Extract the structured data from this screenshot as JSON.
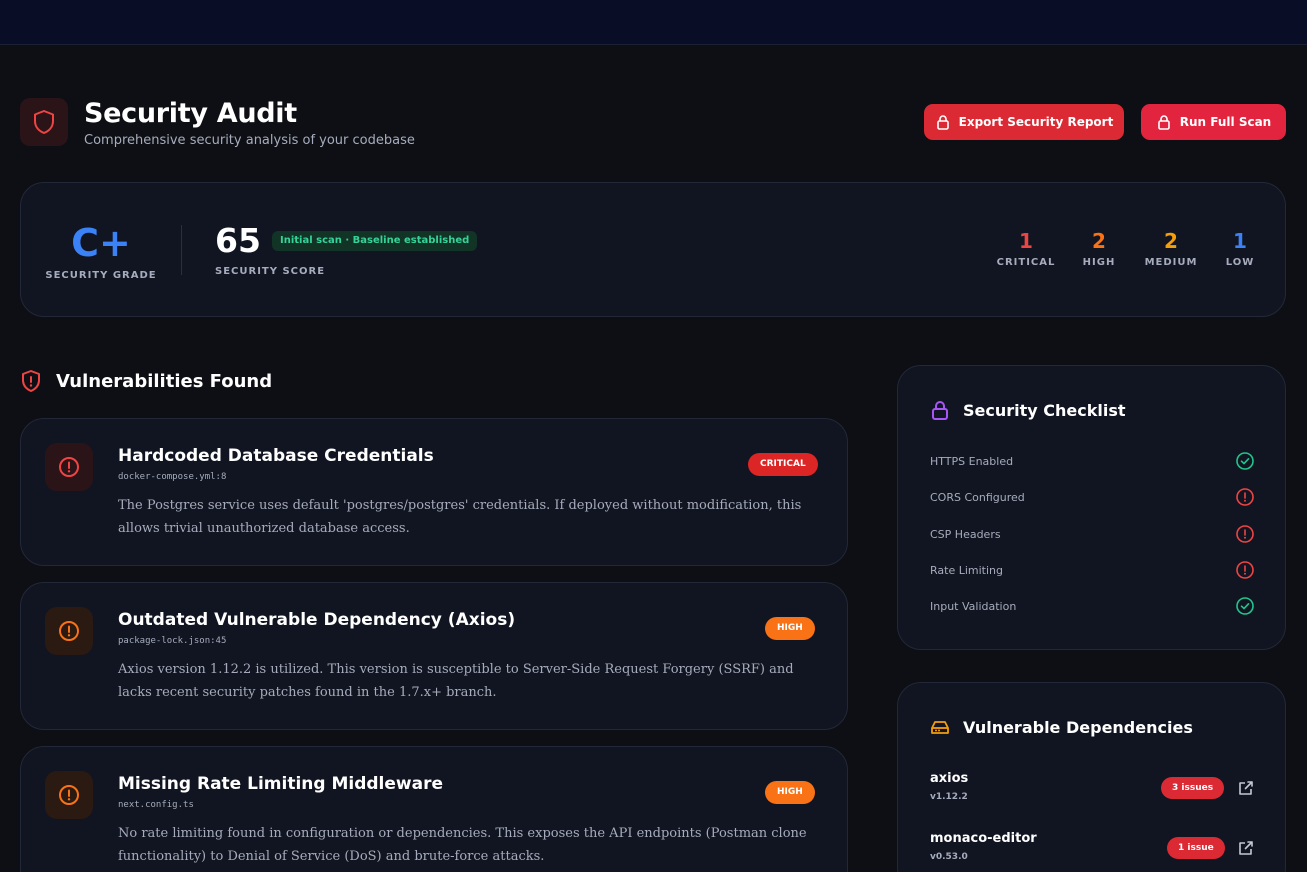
{
  "header": {
    "title": "Security Audit",
    "subtitle": "Comprehensive security analysis of your codebase",
    "export_label": "Export Security Report",
    "scan_label": "Run Full Scan"
  },
  "score_card": {
    "grade": "C+",
    "grade_label": "SECURITY GRADE",
    "score": "65",
    "score_badge": "Initial scan · Baseline established",
    "score_label": "SECURITY SCORE",
    "severities": [
      {
        "count": "1",
        "label": "CRITICAL",
        "color": "#ef4444"
      },
      {
        "count": "2",
        "label": "HIGH",
        "color": "#f97316"
      },
      {
        "count": "2",
        "label": "MEDIUM",
        "color": "#f59e0b"
      },
      {
        "count": "1",
        "label": "LOW",
        "color": "#3b82f6"
      }
    ]
  },
  "vulnerabilities": {
    "section_title": "Vulnerabilities Found",
    "items": [
      {
        "title": "Hardcoded Database Credentials",
        "file": "docker-compose.yml:8",
        "description": "The Postgres service uses default 'postgres/postgres' credentials. If deployed without modification, this allows trivial unauthorized database access.",
        "severity": "CRITICAL",
        "severity_color": "#dc2626"
      },
      {
        "title": "Outdated Vulnerable Dependency (Axios)",
        "file": "package-lock.json:45",
        "description": "Axios version 1.12.2 is utilized. This version is susceptible to Server-Side Request Forgery (SSRF) and lacks recent security patches found in the 1.7.x+ branch.",
        "severity": "HIGH",
        "severity_color": "#f97316"
      },
      {
        "title": "Missing Rate Limiting Middleware",
        "file": "next.config.ts",
        "description": "No rate limiting found in configuration or dependencies. This exposes the API endpoints (Postman clone functionality) to Denial of Service (DoS) and brute-force attacks.",
        "severity": "HIGH",
        "severity_color": "#f97316"
      }
    ]
  },
  "checklist": {
    "title": "Security Checklist",
    "items": [
      {
        "label": "HTTPS Enabled",
        "status": "pass"
      },
      {
        "label": "CORS Configured",
        "status": "fail"
      },
      {
        "label": "CSP Headers",
        "status": "fail"
      },
      {
        "label": "Rate Limiting",
        "status": "fail"
      },
      {
        "label": "Input Validation",
        "status": "pass"
      }
    ]
  },
  "dependencies": {
    "title": "Vulnerable Dependencies",
    "items": [
      {
        "name": "axios",
        "version": "v1.12.2",
        "issues": "3 issues"
      },
      {
        "name": "monaco-editor",
        "version": "v0.53.0",
        "issues": "1 issue"
      }
    ]
  }
}
